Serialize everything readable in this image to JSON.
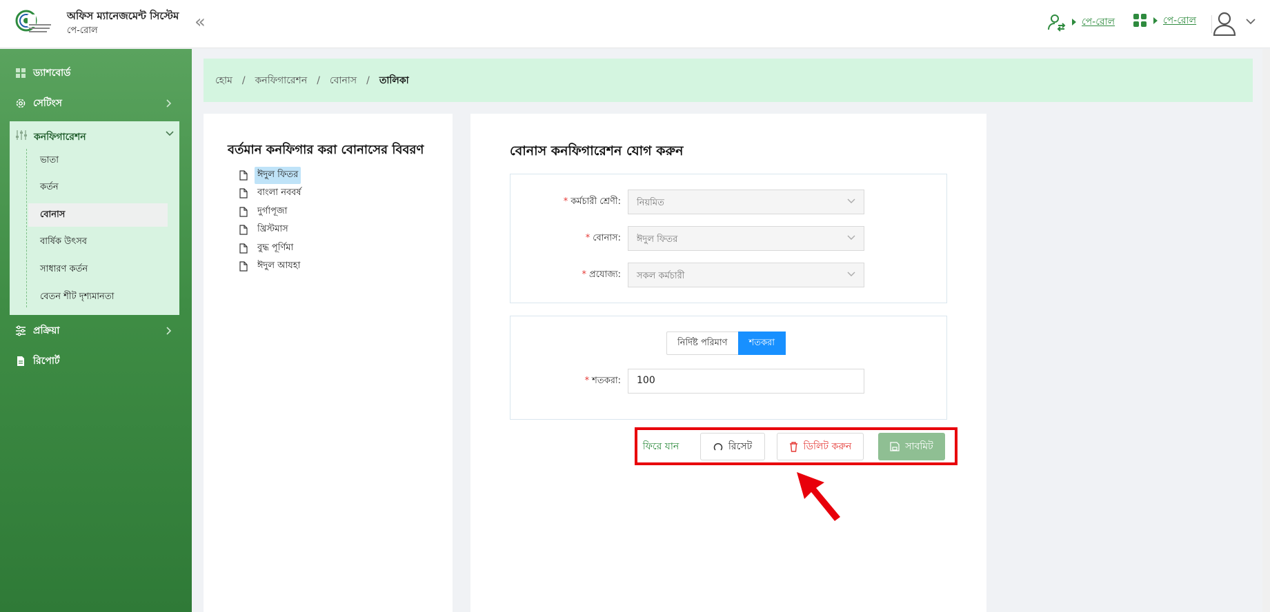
{
  "header": {
    "app_title": "অফিস ম্যানেজমেন্ট সিস্টেম",
    "app_subtitle": "পে-রোল",
    "collapse_glyph": "«",
    "link1": "পে-রোল",
    "link2": "পে-রোল"
  },
  "sidebar": {
    "dashboard": "ড্যাশবোর্ড",
    "settings": "সেটিংস",
    "configuration": "কনফিগারেশন",
    "sub_items": [
      "ভাতা",
      "কর্তন",
      "বোনাস",
      "বার্ষিক উৎসব",
      "সাধারণ কর্তন",
      "বেতন শীট দৃশ্যমানতা"
    ],
    "process": "প্রক্রিয়া",
    "report": "রিপোর্ট"
  },
  "breadcrumb": {
    "home": "হোম",
    "config": "কনফিগারেশন",
    "bonus": "বোনাস",
    "current": "তালিকা"
  },
  "left_panel": {
    "title": "বর্তমান কনফিগার করা বোনাসের বিবরণ",
    "items": [
      "ঈদুল ফিতর",
      "বাংলা নববর্ষ",
      "দুর্গাপূজা",
      "খ্রিস্টমাস",
      "বুদ্ধ পূর্ণিমা",
      "ঈদুল আযহা"
    ]
  },
  "form": {
    "title": "বোনাস কনফিগারেশন যোগ করুন",
    "employee_class_label": "কর্মচারী শ্রেণী:",
    "employee_class_value": "নিয়মিত",
    "bonus_label": "বোনাস:",
    "bonus_value": "ঈদুল ফিতর",
    "applicable_label": "প্রযোজ্য:",
    "applicable_value": "সকল কর্মচারী",
    "seg_fixed": "নির্দিষ্ট পরিমাণ",
    "seg_percent": "শতকরা",
    "percent_label": "শতকরা:",
    "percent_value": "100"
  },
  "actions": {
    "back": "ফিরে যান",
    "reset": "রিসেট",
    "delete": "ডিলিট করুন",
    "submit": "সাবমিট"
  },
  "colors": {
    "brand_green": "#2e8b3e",
    "primary_blue": "#1890ff",
    "danger_red": "#e53935",
    "highlight_red": "#e8000b"
  }
}
